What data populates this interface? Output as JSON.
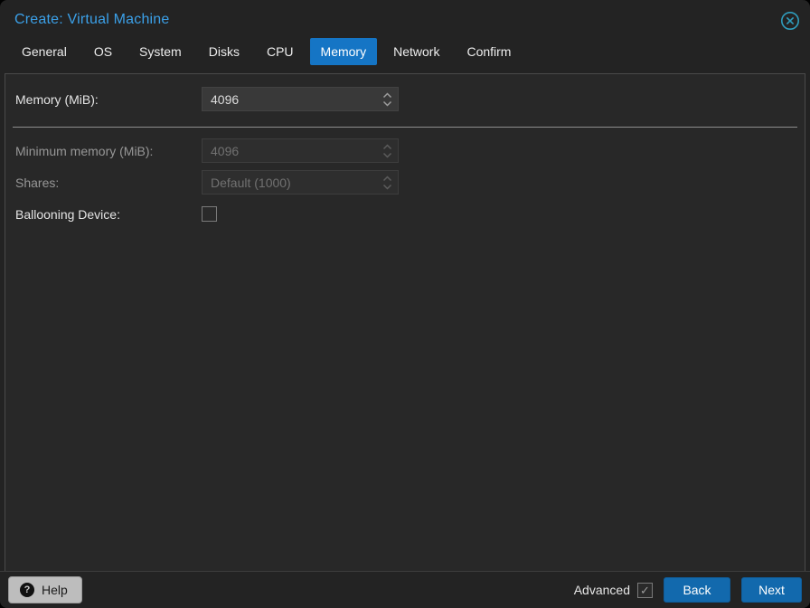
{
  "dialog": {
    "title": "Create: Virtual Machine"
  },
  "tabs": [
    {
      "label": "General",
      "active": false
    },
    {
      "label": "OS",
      "active": false
    },
    {
      "label": "System",
      "active": false
    },
    {
      "label": "Disks",
      "active": false
    },
    {
      "label": "CPU",
      "active": false
    },
    {
      "label": "Memory",
      "active": true
    },
    {
      "label": "Network",
      "active": false
    },
    {
      "label": "Confirm",
      "active": false
    }
  ],
  "form": {
    "memory": {
      "label": "Memory (MiB):",
      "value": "4096",
      "enabled": true
    },
    "min_memory": {
      "label": "Minimum memory (MiB):",
      "value": "4096",
      "enabled": false
    },
    "shares": {
      "label": "Shares:",
      "value": "Default (1000)",
      "enabled": false
    },
    "ballooning": {
      "label": "Ballooning Device:",
      "checked": false
    }
  },
  "footer": {
    "help_label": "Help",
    "advanced_label": "Advanced",
    "advanced_checked": true,
    "back_label": "Back",
    "next_label": "Next"
  },
  "icons": {
    "close_icon": "circle-x",
    "help_icon_glyph": "?",
    "check_glyph": "✓",
    "spinner_icon": "up-down-chevrons"
  },
  "colors": {
    "accent_blue": "#1575c5",
    "title_blue": "#3ba0e8",
    "button_blue": "#1269ad",
    "close_teal": "#2f9dbd"
  }
}
